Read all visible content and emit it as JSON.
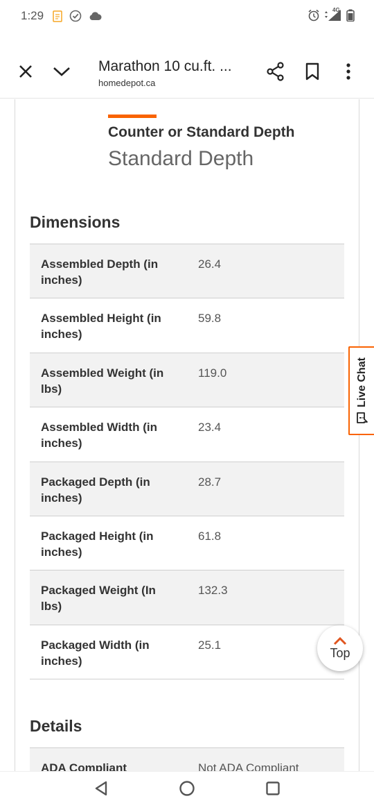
{
  "status_bar": {
    "time": "1:29",
    "network": "4G"
  },
  "toolbar": {
    "title": "Marathon 10 cu.ft. ...",
    "domain": "homedepot.ca"
  },
  "spec_header": {
    "label": "Counter or Standard Depth",
    "value": "Standard Depth"
  },
  "dimensions": {
    "title": "Dimensions",
    "rows": [
      {
        "name": "Assembled Depth (in inches)",
        "value": "26.4"
      },
      {
        "name": "Assembled Height (in inches)",
        "value": "59.8"
      },
      {
        "name": "Assembled Weight (in lbs)",
        "value": "119.0"
      },
      {
        "name": "Assembled Width (in inches)",
        "value": "23.4"
      },
      {
        "name": "Packaged Depth (in inches)",
        "value": "28.7"
      },
      {
        "name": "Packaged Height (in inches)",
        "value": "61.8"
      },
      {
        "name": "Packaged Weight (In lbs)",
        "value": "132.3"
      },
      {
        "name": "Packaged Width (in inches)",
        "value": "25.1"
      }
    ]
  },
  "details": {
    "title": "Details",
    "rows": [
      {
        "name": "ADA Compliant",
        "value": "Not ADA Compliant"
      }
    ]
  },
  "live_chat": {
    "label": "Live Chat"
  },
  "top_button": {
    "label": "Top"
  },
  "colors": {
    "accent": "#f96302"
  }
}
